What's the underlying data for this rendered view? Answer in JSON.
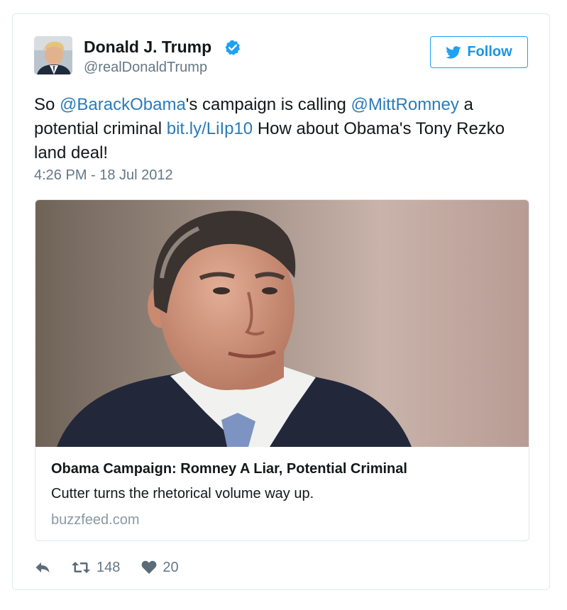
{
  "author": {
    "display_name": "Donald J. Trump",
    "handle": "@realDonaldTrump",
    "verified": true
  },
  "follow_button": {
    "label": "Follow",
    "icon": "twitter-bird-icon"
  },
  "tweet": {
    "segments": [
      {
        "type": "text",
        "value": "So "
      },
      {
        "type": "mention",
        "value": "@BarackObama"
      },
      {
        "type": "text",
        "value": "'s campaign is calling "
      },
      {
        "type": "mention",
        "value": "@MittRomney"
      },
      {
        "type": "text",
        "value": " a potential criminal "
      },
      {
        "type": "link",
        "value": "bit.ly/LiIp10"
      },
      {
        "type": "text",
        "value": " How about Obama's Tony Rezko land deal!"
      }
    ],
    "timestamp": "4:26 PM - 18 Jul 2012"
  },
  "card": {
    "title": "Obama Campaign: Romney A Liar, Potential Criminal",
    "description": "Cutter turns the rhetorical volume way up.",
    "domain": "buzzfeed.com"
  },
  "actions": {
    "reply_icon": "reply-icon",
    "retweet_icon": "retweet-icon",
    "retweet_count": "148",
    "like_icon": "heart-icon",
    "like_count": "20"
  },
  "colors": {
    "link": "#2b7bb9",
    "follow": "#1b95e0",
    "verified": "#1da1f2",
    "muted": "#657786",
    "border": "#e1e8ed"
  }
}
